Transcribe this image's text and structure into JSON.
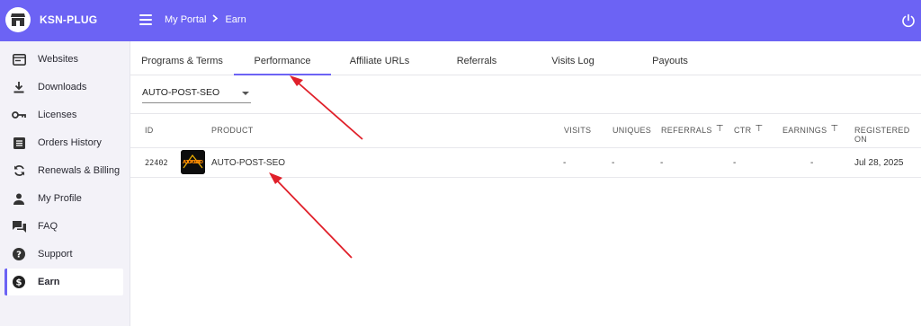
{
  "app": {
    "name": "KSN-PLUG"
  },
  "breadcrumb": {
    "parent": "My Portal",
    "current": "Earn"
  },
  "sidebar": {
    "items": [
      {
        "label": "Websites",
        "icon": "monitor-icon"
      },
      {
        "label": "Downloads",
        "icon": "download-icon"
      },
      {
        "label": "Licenses",
        "icon": "key-icon"
      },
      {
        "label": "Orders History",
        "icon": "list-icon"
      },
      {
        "label": "Renewals & Billing",
        "icon": "refresh-icon"
      },
      {
        "label": "My Profile",
        "icon": "person-icon"
      },
      {
        "label": "FAQ",
        "icon": "chat-icon"
      },
      {
        "label": "Support",
        "icon": "question-icon"
      },
      {
        "label": "Earn",
        "icon": "dollar-icon",
        "active": true
      }
    ]
  },
  "tabs": [
    {
      "label": "Programs & Terms"
    },
    {
      "label": "Performance",
      "active": true
    },
    {
      "label": "Affiliate URLs"
    },
    {
      "label": "Referrals"
    },
    {
      "label": "Visits Log"
    },
    {
      "label": "Payouts"
    }
  ],
  "product_select": {
    "value": "AUTO-POST-SEO"
  },
  "table": {
    "headers": {
      "id": "ID",
      "product": "PRODUCT",
      "visits": "VISITS",
      "uniques": "UNIQUES",
      "referrals": "REFERRALS",
      "ctr": "CTR",
      "earnings": "EARNINGS",
      "registered_on": "REGISTERED ON"
    },
    "rows": [
      {
        "id": "22402",
        "product": "AUTO-POST-SEO",
        "thumb_text": "AUTO-POST SEO",
        "visits": "-",
        "uniques": "-",
        "referrals": "-",
        "ctr": "-",
        "earnings": "-",
        "registered_on": "Jul 28, 2025"
      }
    ]
  },
  "colors": {
    "accent": "#6c63f4",
    "annotation_arrow": "#e0202a"
  }
}
